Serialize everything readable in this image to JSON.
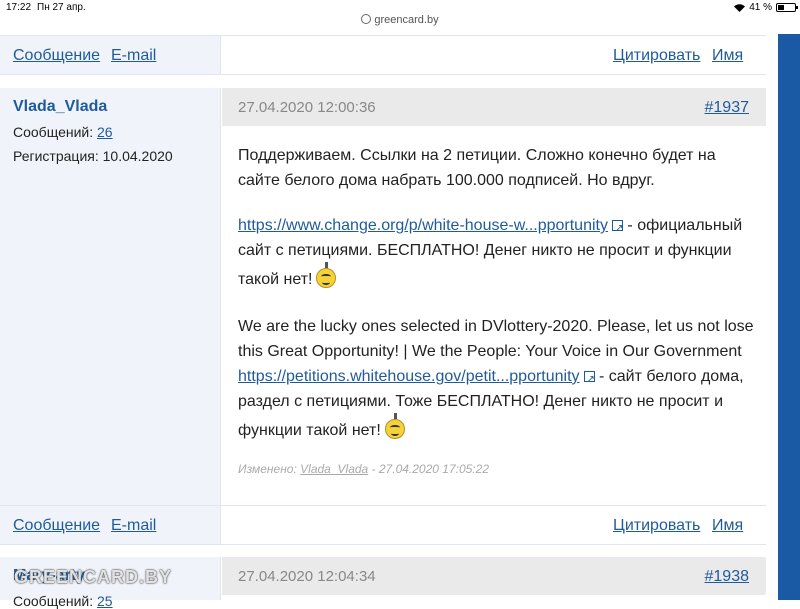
{
  "statusbar": {
    "time": "17:22",
    "date": "Пн 27 апр.",
    "url": "greencard.by",
    "battery": "41 %"
  },
  "actions": {
    "message": "Сообщение",
    "email": "E-mail",
    "quote": "Цитировать",
    "name": "Имя"
  },
  "post1": {
    "author": "Vlada_Vlada",
    "messages_label": "Сообщений:",
    "messages_count": "26",
    "registration": "Регистрация: 10.04.2020",
    "date": "27.04.2020 12:00:36",
    "number": "#1937",
    "p1_line1": "Поддерживаем. Ссылки на 2 петиции. Сложно конечно будет на",
    "p1_line2": "сайте белого дома набрать 100.000 подписей. Но вдруг.",
    "link1": "https://www.change.org/p/white-house-w...pportunity",
    "p2_after_link": " - официальный",
    "p2_line2": "сайт с петициями. БЕСПЛАТНО! Денег никто не просит и функции",
    "p2_line3": "такой нет!",
    "p3_line1": "We are the lucky ones selected in DVlottery-2020. Please, let us not lose",
    "p3_line2": "this Great Opportunity! | We the People: Your Voice in Our Government",
    "link2": "https://petitions.whitehouse.gov/petit...pportunity",
    "p3_after_link": " - сайт белого дома,",
    "p3_line4": "раздел с петициями. Тоже БЕСПЛАТНО! Денег никто не просит и",
    "p3_line5": "функции такой нет!",
    "edited_label": "Изменено: ",
    "edited_user": "Vlada_Vlada",
    "edited_time": " - 27.04.2020 17:05:22"
  },
  "post2": {
    "author": "Mary-arty",
    "messages_label": "Сообщений:",
    "messages_count": "25",
    "date": "27.04.2020 12:04:34",
    "number": "#1938"
  },
  "watermark": "GREENCARD.BY"
}
